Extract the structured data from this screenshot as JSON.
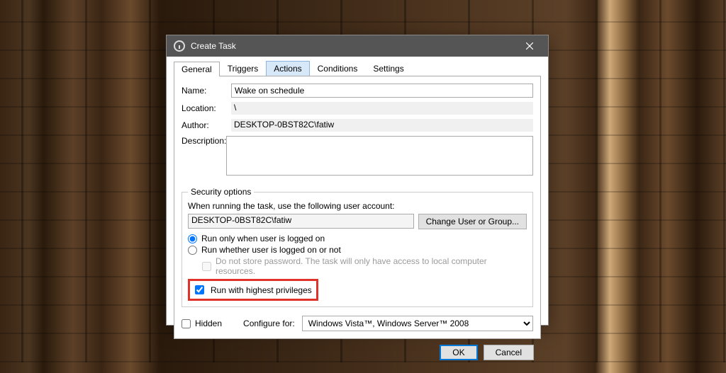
{
  "window": {
    "title": "Create Task"
  },
  "tabs": {
    "general": "General",
    "triggers": "Triggers",
    "actions": "Actions",
    "conditions": "Conditions",
    "settings": "Settings"
  },
  "labels": {
    "name": "Name:",
    "location": "Location:",
    "author": "Author:",
    "description": "Description:",
    "security_legend": "Security options",
    "security_line": "When running the task, use the following user account:",
    "change_user": "Change User or Group...",
    "run_logged_on": "Run only when user is logged on",
    "run_logged_off": "Run whether user is logged on or not",
    "do_not_store": "Do not store password.  The task will only have access to local computer resources.",
    "highest_priv": "Run with highest privileges",
    "hidden": "Hidden",
    "configure_for": "Configure for:",
    "ok": "OK",
    "cancel": "Cancel"
  },
  "values": {
    "name": "Wake on schedule",
    "location": "\\",
    "author": "DESKTOP-0BST82C\\fatiw",
    "description": "",
    "account": "DESKTOP-0BST82C\\fatiw",
    "configure_for": "Windows Vista™, Windows Server™ 2008"
  },
  "state": {
    "run_mode": "logged_on",
    "do_not_store_checked": false,
    "highest_priv_checked": true,
    "hidden_checked": false
  }
}
